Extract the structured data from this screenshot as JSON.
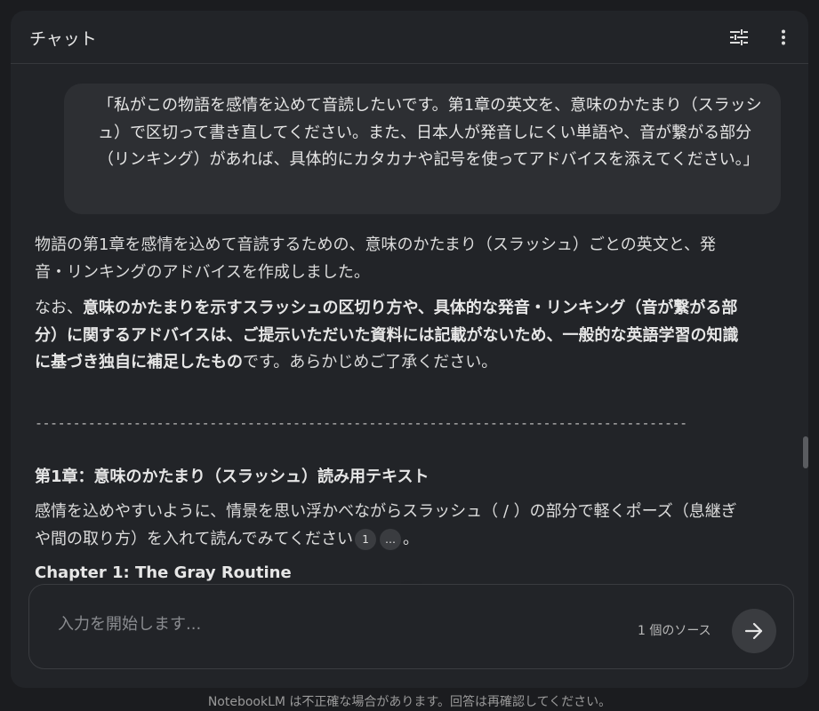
{
  "header": {
    "title": "チャット",
    "tune_icon": "tune-icon",
    "more_icon": "more-vert-icon"
  },
  "messages": {
    "user_prompt": "「私がこの物語を感情を込めて音読したいです。第1章の英文を、意味のかたまり（スラッシュ）で区切って書き直してください。また、日本人が発音しにくい単語や、音が繋がる部分（リンキング）があれば、具体的にカタカナや記号を使ってアドバイスを添えてください。」",
    "response": {
      "intro": "物語の第1章を感情を込めて音読するための、意味のかたまり（スラッシュ）ごとの英文と、発音・リンキングのアドバイスを作成しました。",
      "note_prefix": "なお、",
      "note_bold": "意味のかたまりを示すスラッシュの区切り方や、具体的な発音・リンキング（音が繋がる部分）に関するアドバイスは、ご提示いただいた資料には記載がないため、一般的な英語学習の知識に基づき独自に補足したもの",
      "note_suffix": "です。あらかじめご了承ください。",
      "divider": "---------------------------------------------------------------------------------------",
      "section_heading": "第1章：意味のかたまり（スラッシュ）読み用テキスト",
      "section_text": "感情を込めやすいように、情景を思い浮かべながらスラッシュ（ / ）の部分で軽くポーズ（息継ぎや間の取り方）を入れて読んでみてください",
      "citation_1": "1",
      "citation_more": "…",
      "section_end": "。",
      "chapter_title": "Chapter 1: The Gray Routine"
    }
  },
  "composer": {
    "placeholder": "入力を開始します...",
    "source_count": "1 個のソース",
    "send_icon": "arrow-right-icon"
  },
  "scroll_down_icon": "chevron-down-icon",
  "footer": {
    "disclaimer": "NotebookLM は不正確な場合があります。回答は再確認してください。"
  }
}
